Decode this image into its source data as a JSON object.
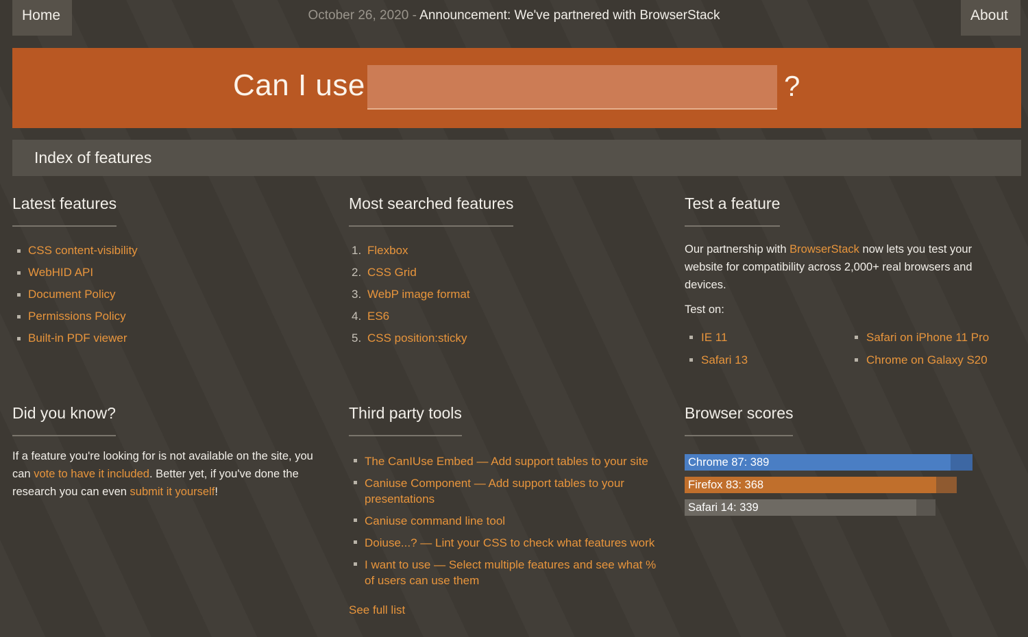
{
  "nav": {
    "home": "Home",
    "about": "About",
    "announcement_date": "October 26, 2020",
    "announcement_sep": " - ",
    "announcement_text": "Announcement: We've partnered with BrowserStack"
  },
  "search": {
    "label": "Can I use",
    "value": "",
    "suffix": "?"
  },
  "index_title": "Index of features",
  "latest": {
    "title": "Latest features",
    "items": [
      "CSS content-visibility",
      "WebHID API",
      "Document Policy",
      "Permissions Policy",
      "Built-in PDF viewer"
    ]
  },
  "most_searched": {
    "title": "Most searched features",
    "items": [
      {
        "num": "1.",
        "label": "Flexbox"
      },
      {
        "num": "2.",
        "label": "CSS Grid"
      },
      {
        "num": "3.",
        "label": "WebP image format"
      },
      {
        "num": "4.",
        "label": "ES6"
      },
      {
        "num": "5.",
        "label": "CSS position:sticky"
      }
    ]
  },
  "test_feature": {
    "title": "Test a feature",
    "desc_pre": "Our partnership with ",
    "desc_link": "BrowserStack",
    "desc_post": " now lets you test your website for compatibility across 2,000+ real browsers and devices.",
    "test_on": "Test on:",
    "targets": [
      "IE 11",
      "Safari on iPhone 11 Pro",
      "Safari 13",
      "Chrome on Galaxy S20"
    ]
  },
  "did_you_know": {
    "title": "Did you know?",
    "text1": "If a feature you're looking for is not available on the site, you can ",
    "link1": "vote to have it included",
    "text2": ". Better yet, if you've done the research you can even ",
    "link2": "submit it yourself",
    "text3": "!"
  },
  "third_party": {
    "title": "Third party tools",
    "items": [
      "The CanIUse Embed — Add support tables to your site",
      "Caniuse Component — Add support tables to your presentations",
      "Caniuse command line tool",
      "Doiuse...? — Lint your CSS to check what features work",
      "I want to use — Select multiple features and see what % of users can use them"
    ],
    "see_full": "See full list"
  },
  "browser_scores": {
    "title": "Browser scores",
    "max": 400,
    "items": [
      {
        "label": "Chrome 87: 389",
        "value": 389,
        "fill": "#4a7ec4",
        "track": "#3d67a3"
      },
      {
        "label": "Firefox 83: 368",
        "value": 368,
        "fill": "#c06f2c",
        "track": "#8f5a30"
      },
      {
        "label": "Safari 14: 339",
        "value": 339,
        "fill": "#6e6a63",
        "track": "#5a5650"
      }
    ]
  }
}
